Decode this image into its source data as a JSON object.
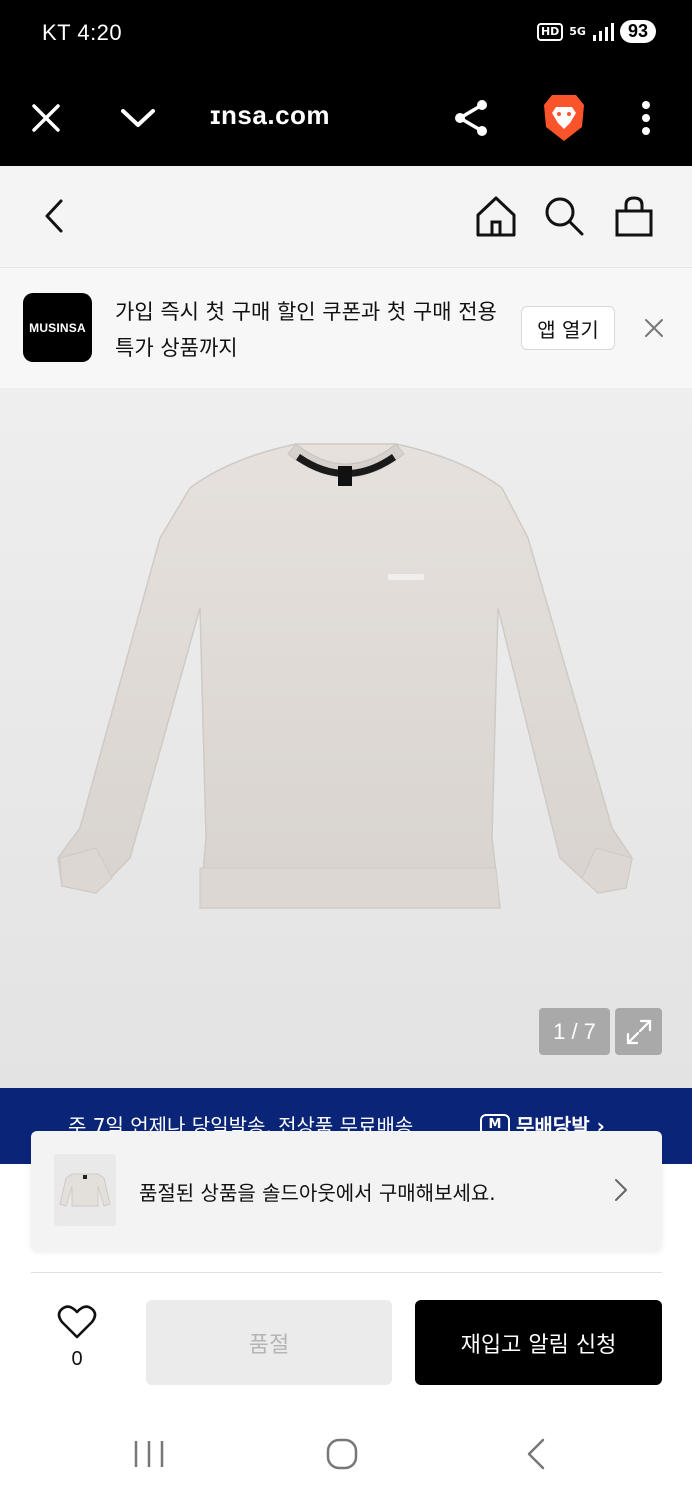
{
  "status_bar": {
    "carrier_time": "KT 4:20",
    "hd_label": "HD",
    "network_label": "5G",
    "battery": "93"
  },
  "browser": {
    "url": "ɪnsa.com",
    "icons": [
      "close-icon",
      "chevron-down-icon",
      "share-icon",
      "brave-lion-icon",
      "more-vert-icon"
    ]
  },
  "site_header": {
    "icons": [
      "back-icon",
      "home-icon",
      "search-icon",
      "bag-icon"
    ]
  },
  "app_banner": {
    "logo_text": "MUSINSA",
    "message": "가입 즉시 첫 구매 할인 쿠폰과 첫 구매 전용 특가 상품까지",
    "open_app_label": "앱 열기"
  },
  "product_image": {
    "counter": "1 / 7"
  },
  "promo": {
    "text": "주 7일 언제나 당일발송, 전상품 무료배송",
    "badge_mark": "M",
    "badge_text": "무배당발 ›"
  },
  "soldout_card": {
    "text": "품절된 상품을 솔드아웃에서 구매해보세요."
  },
  "bottom_bar": {
    "like_count": "0",
    "soldout_label": "품절",
    "restock_label": "재입고 알림 신청"
  },
  "colors": {
    "promo_bg": "#0a2478",
    "primary_button": "#000000",
    "disabled_button": "#ebebeb"
  }
}
